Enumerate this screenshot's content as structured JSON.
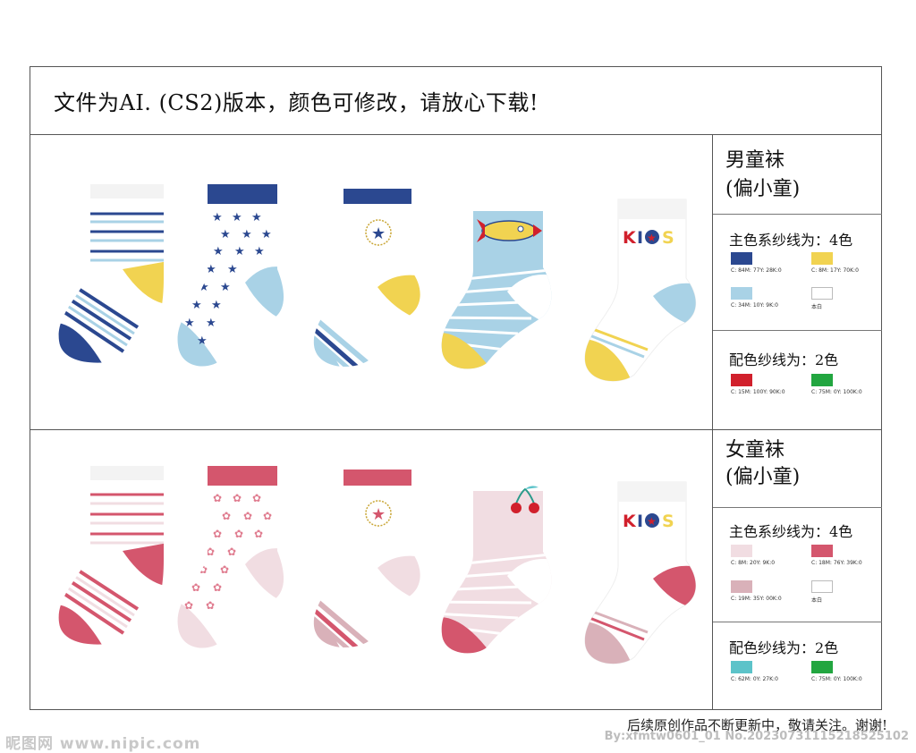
{
  "header": {
    "title": "文件为AI. (CS2)版本，颜色可修改，请放心下载!"
  },
  "boys": {
    "title_line1": "男童袜",
    "title_line2": "(偏小童)",
    "main_title": "主色系纱线为：4色",
    "main_swatches": [
      {
        "color": "#2b4890",
        "label": "C: 84M: 77Y: 28K:0"
      },
      {
        "color": "#f1d351",
        "label": "C: 8M: 17Y: 70K:0"
      },
      {
        "color": "#a9d2e6",
        "label": "C: 34M: 10Y: 9K:0"
      },
      {
        "color": "#ffffff",
        "label": "本白"
      }
    ],
    "accent_title": "配色纱线为：2色",
    "accent_swatches": [
      {
        "color": "#d1202c",
        "label": "C: 15M: 100Y: 90K:0"
      },
      {
        "color": "#22a640",
        "label": "C: 75M: 0Y: 100K:0"
      }
    ],
    "kids_text": "KIDS"
  },
  "girls": {
    "title_line1": "女童袜",
    "title_line2": "(偏小童)",
    "main_title": "主色系纱线为：4色",
    "main_swatches": [
      {
        "color": "#f1dde2",
        "label": "C: 8M: 20Y: 9K:0"
      },
      {
        "color": "#d4566d",
        "label": "C: 18M: 76Y: 39K:0"
      },
      {
        "color": "#d9b1b9",
        "label": "C: 19M: 35Y: 00K:0"
      },
      {
        "color": "#ffffff",
        "label": "本白"
      }
    ],
    "accent_title": "配色纱线为：2色",
    "accent_swatches": [
      {
        "color": "#5cc3c9",
        "label": "C: 62M: 0Y: 27K:0"
      },
      {
        "color": "#22a640",
        "label": "C: 75M: 0Y: 100K:0"
      }
    ],
    "kids_text": "KIDS"
  },
  "footer": {
    "text": "后续原创作品不断更新中，敬请关注。谢谢!"
  },
  "watermark": {
    "left": "昵图网 www.nipic.com",
    "right": "By:xfmtw0601_01 No.20230731115218525102"
  }
}
